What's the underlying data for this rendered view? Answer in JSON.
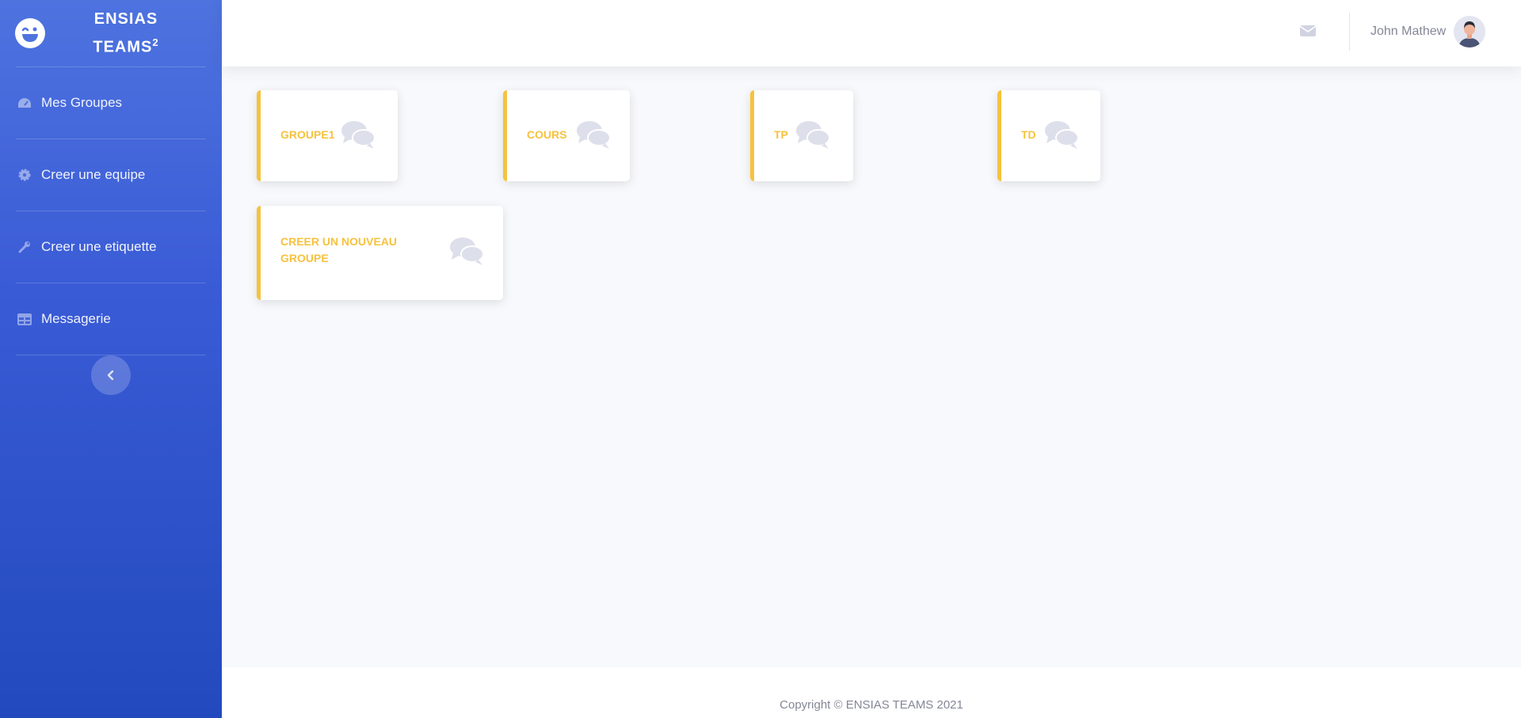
{
  "brand": {
    "line1": "ENSIAS",
    "line2": "TEAMS",
    "sup": "2",
    "icon": "laugh-wink-icon"
  },
  "sidebar": {
    "items": [
      {
        "label": "Mes Groupes",
        "icon": "tachometer-icon"
      },
      {
        "label": "Creer une equipe",
        "icon": "gear-icon"
      },
      {
        "label": "Creer une etiquette",
        "icon": "wrench-icon"
      },
      {
        "label": "Messagerie",
        "icon": "table-icon"
      }
    ],
    "toggle_icon": "chevron-left-icon"
  },
  "topbar": {
    "user_name": "John Mathew",
    "mail_icon": "envelope-icon"
  },
  "cards": [
    {
      "title": "GROUPE1",
      "icon": "comments-icon"
    },
    {
      "title": "COURS",
      "icon": "comments-icon"
    },
    {
      "title": "TP",
      "icon": "comments-icon"
    },
    {
      "title": "TD",
      "icon": "comments-icon"
    },
    {
      "title": "CREER UN NOUVEAU GROUPE",
      "icon": "comments-icon"
    }
  ],
  "footer": {
    "text": "Copyright © ENSIAS TEAMS 2021"
  },
  "colors": {
    "sidebar_top": "#4e73df",
    "sidebar_bottom": "#224abe",
    "accent": "#f6c23e",
    "muted": "#858796",
    "background": "#f8f9fc"
  }
}
